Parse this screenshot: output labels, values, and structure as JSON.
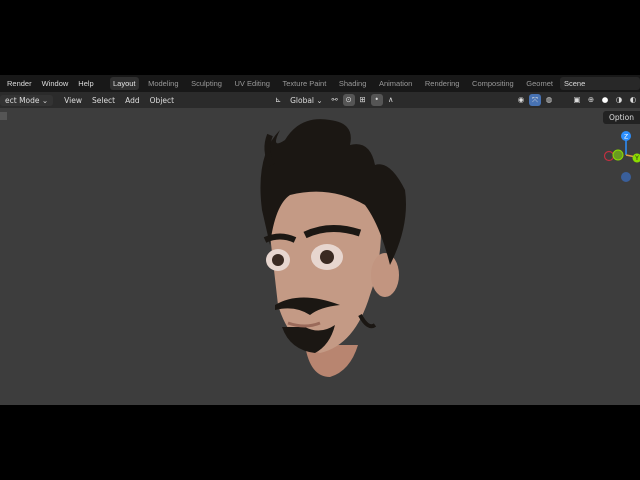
{
  "topbar": {
    "menus": [
      "Render",
      "Window",
      "Help"
    ],
    "workspaces": [
      "Layout",
      "Modeling",
      "Sculpting",
      "UV Editing",
      "Texture Paint",
      "Shading",
      "Animation",
      "Rendering",
      "Compositing",
      "Geomet"
    ],
    "active_workspace": "Layout",
    "scene": "Scene"
  },
  "toolbar": {
    "mode": "ect Mode",
    "menus": [
      "View",
      "Select",
      "Add",
      "Object"
    ],
    "orientation": "Global"
  },
  "viewport": {
    "options_label": "Option",
    "gizmo": {
      "z": "Z",
      "y": "Y"
    }
  },
  "colors": {
    "active_blue": "#4772b3",
    "gizmo_z": "#2c8fff",
    "gizmo_y": "#8bdc00",
    "gizmo_x": "#ff3352"
  }
}
